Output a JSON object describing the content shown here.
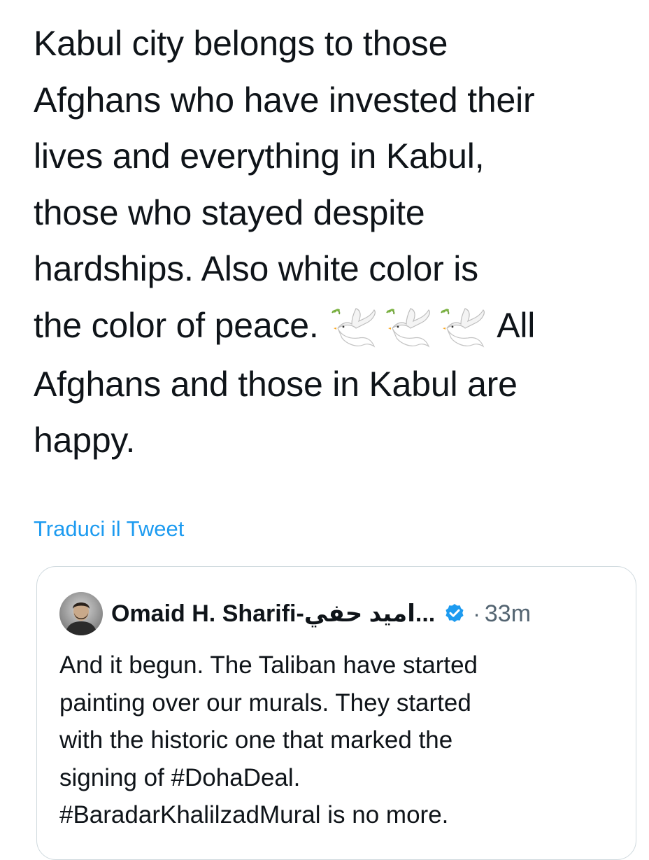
{
  "tweet": {
    "text_lines": [
      "Kabul city belongs to those",
      "Afghans who have invested their",
      "lives and everything in Kabul,",
      "those who stayed despite",
      "hardships. Also white color is",
      "the color of peace."
    ],
    "text_after_emoji": "All",
    "text_lines_end": [
      "Afghans and those in Kabul are",
      "happy."
    ],
    "emoji": [
      "dove-icon",
      "dove-icon",
      "dove-icon"
    ],
    "translate_label": "Traduci il Tweet"
  },
  "quoted_tweet": {
    "author_name": "Omaid H. Sharifi-اميد حفي...",
    "verified": true,
    "separator": "·",
    "time": "33m",
    "text_lines": [
      "And it begun. The Taliban have started",
      "painting over our murals. They started",
      "with the historic one that marked the",
      "signing of #DohaDeal.",
      "#BaradarKhalilzadMural is no more."
    ]
  },
  "colors": {
    "link": "#1d9bf0",
    "text": "#0f1419",
    "muted": "#536471",
    "border": "#cfd9de"
  }
}
